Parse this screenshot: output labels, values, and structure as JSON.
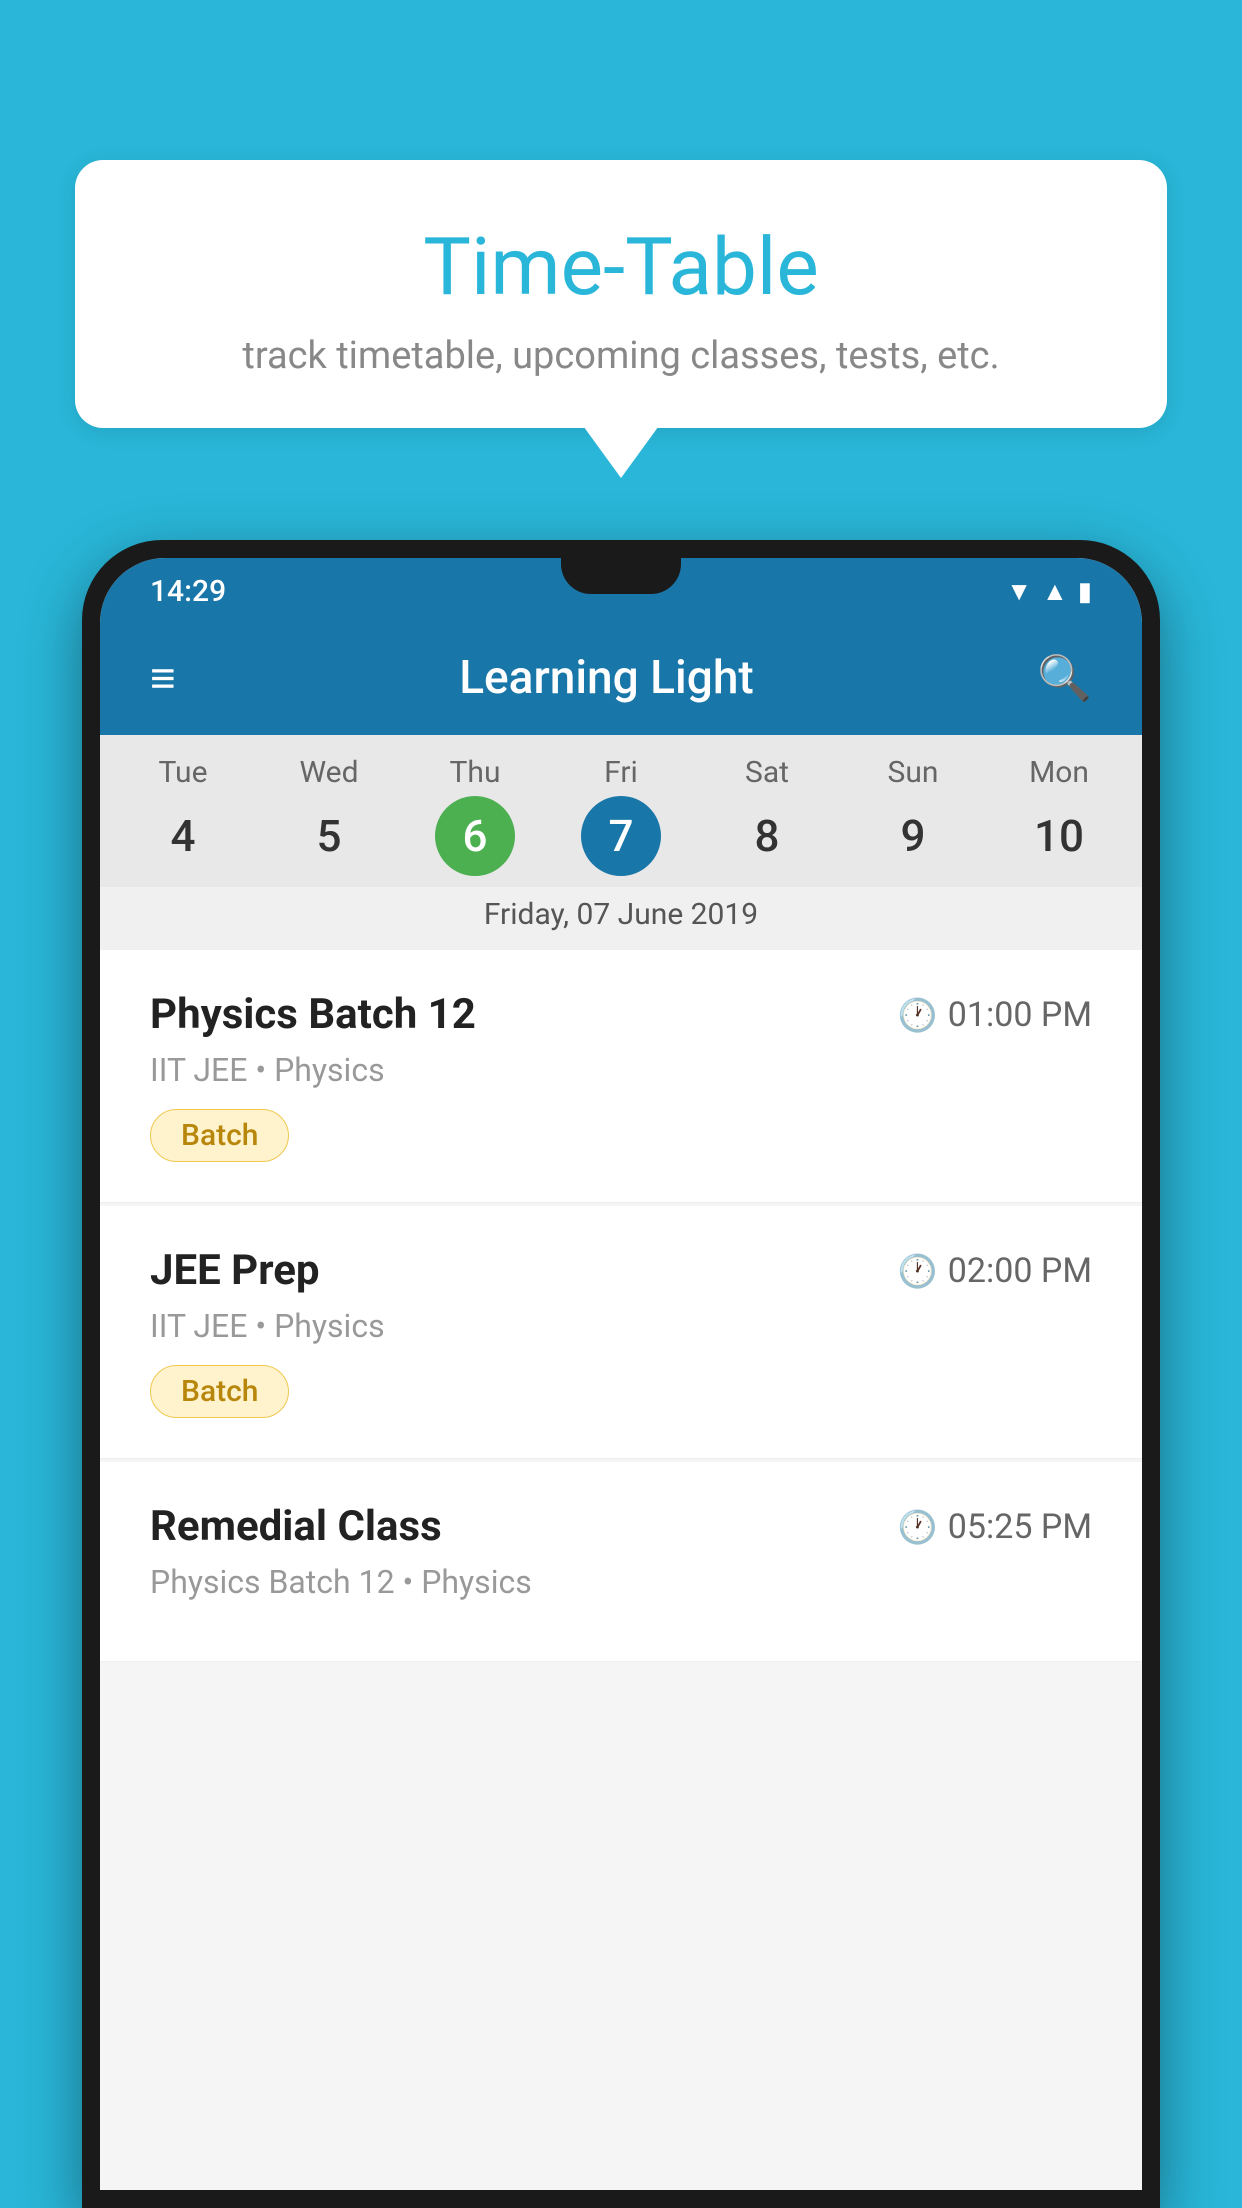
{
  "background_color": "#29b6d8",
  "tooltip": {
    "title": "Time-Table",
    "subtitle": "track timetable, upcoming classes, tests, etc."
  },
  "phone": {
    "status_bar": {
      "time": "14:29",
      "icons": [
        "wifi",
        "signal",
        "battery"
      ]
    },
    "app_bar": {
      "title": "Learning Light",
      "menu_icon": "menu-icon",
      "search_icon": "search-icon"
    },
    "calendar": {
      "days": [
        {
          "label": "Tue",
          "number": "4"
        },
        {
          "label": "Wed",
          "number": "5"
        },
        {
          "label": "Thu",
          "number": "6",
          "state": "today"
        },
        {
          "label": "Fri",
          "number": "7",
          "state": "selected"
        },
        {
          "label": "Sat",
          "number": "8"
        },
        {
          "label": "Sun",
          "number": "9"
        },
        {
          "label": "Mon",
          "number": "10"
        }
      ],
      "selected_date_label": "Friday, 07 June 2019"
    },
    "schedule": [
      {
        "title": "Physics Batch 12",
        "time": "01:00 PM",
        "subtitle": "IIT JEE • Physics",
        "badge": "Batch"
      },
      {
        "title": "JEE Prep",
        "time": "02:00 PM",
        "subtitle": "IIT JEE • Physics",
        "badge": "Batch"
      },
      {
        "title": "Remedial Class",
        "time": "05:25 PM",
        "subtitle": "Physics Batch 12 • Physics",
        "badge": null
      }
    ]
  }
}
